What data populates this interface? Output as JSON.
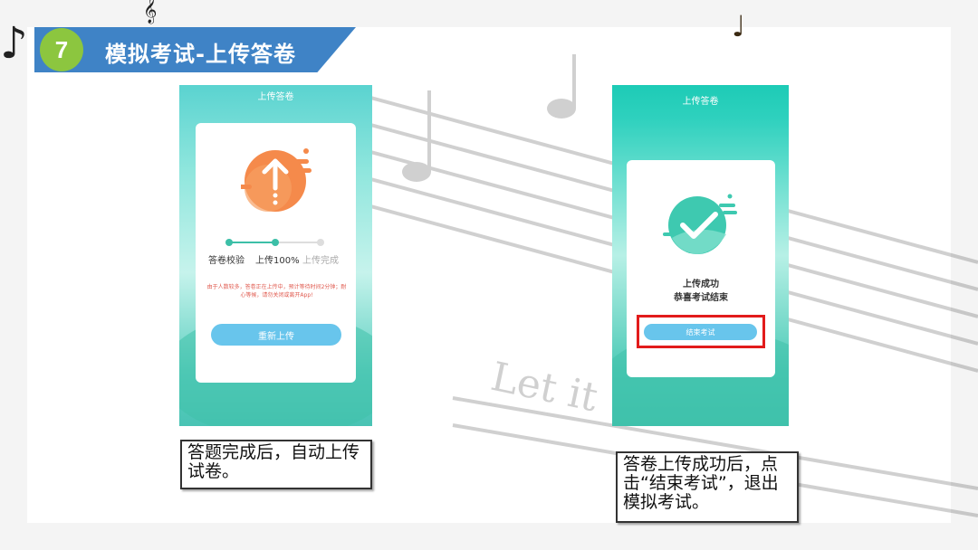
{
  "slide": {
    "step_number": "7",
    "title": "模拟考试-上传答卷"
  },
  "screen_upload": {
    "header": "上传答卷",
    "steps": [
      "答卷校验",
      "上传100%",
      "上传完成"
    ],
    "notice": "由于人数较多，答卷正在上传中，预计等待时间2分钟；耐心等候，请勿关闭或离开App!",
    "reupload_button": "重新上传"
  },
  "screen_success": {
    "header": "上传答卷",
    "status": "上传成功",
    "message": "恭喜考试结束",
    "finish_button": "结束考试"
  },
  "captions": {
    "left": "答题完成后，自动上传试卷。",
    "right": "答卷上传成功后，点击“结束考试”，退出模拟考试。"
  },
  "colors": {
    "title_bar": "#3f83c6",
    "step_circle": "#8cc63f",
    "teal": "#2fd1be",
    "orange_icon": "#f58a4b",
    "button": "#68c5ec",
    "highlight": "#e21b1b",
    "notice_text": "#e05a4f"
  }
}
